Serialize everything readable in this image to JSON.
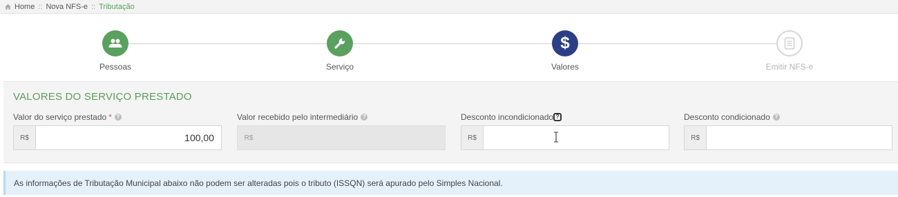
{
  "breadcrumb": {
    "items": [
      "Home",
      "Nova NFS-e",
      "Tributação"
    ],
    "separator": "::"
  },
  "stepper": {
    "steps": [
      {
        "label": "Pessoas",
        "icon": "users-icon",
        "state": "done"
      },
      {
        "label": "Serviço",
        "icon": "wrench-icon",
        "state": "done"
      },
      {
        "label": "Valores",
        "icon": "dollar-icon",
        "state": "current",
        "glyph": "$"
      },
      {
        "label": "Emitir NFS-e",
        "icon": "document-icon",
        "state": "todo"
      }
    ]
  },
  "section": {
    "title": "VALORES DO SERVIÇO PRESTADO",
    "fields": [
      {
        "label": "Valor do serviço prestado",
        "required_mark": "*",
        "prefix": "R$",
        "value": "100,00",
        "help": "?"
      },
      {
        "label": "Valor recebido pelo intermediário",
        "prefix": "R$",
        "value": "",
        "disabled": true,
        "help": "?"
      },
      {
        "label": "Desconto incondicionado",
        "prefix": "R$",
        "value": "",
        "help": "?"
      },
      {
        "label": "Desconto condicionado",
        "prefix": "R$",
        "value": "",
        "help": "?"
      }
    ]
  },
  "alert": {
    "text": "As informações de Tributação Municipal abaixo não podem ser alteradas pois o tributo (ISSQN) será apurado pelo Simples Nacional."
  },
  "colors": {
    "green": "#5aa05e",
    "navy": "#2c3e86",
    "alert_bg": "#e4f1fb",
    "title_green": "#5a9e5a"
  }
}
